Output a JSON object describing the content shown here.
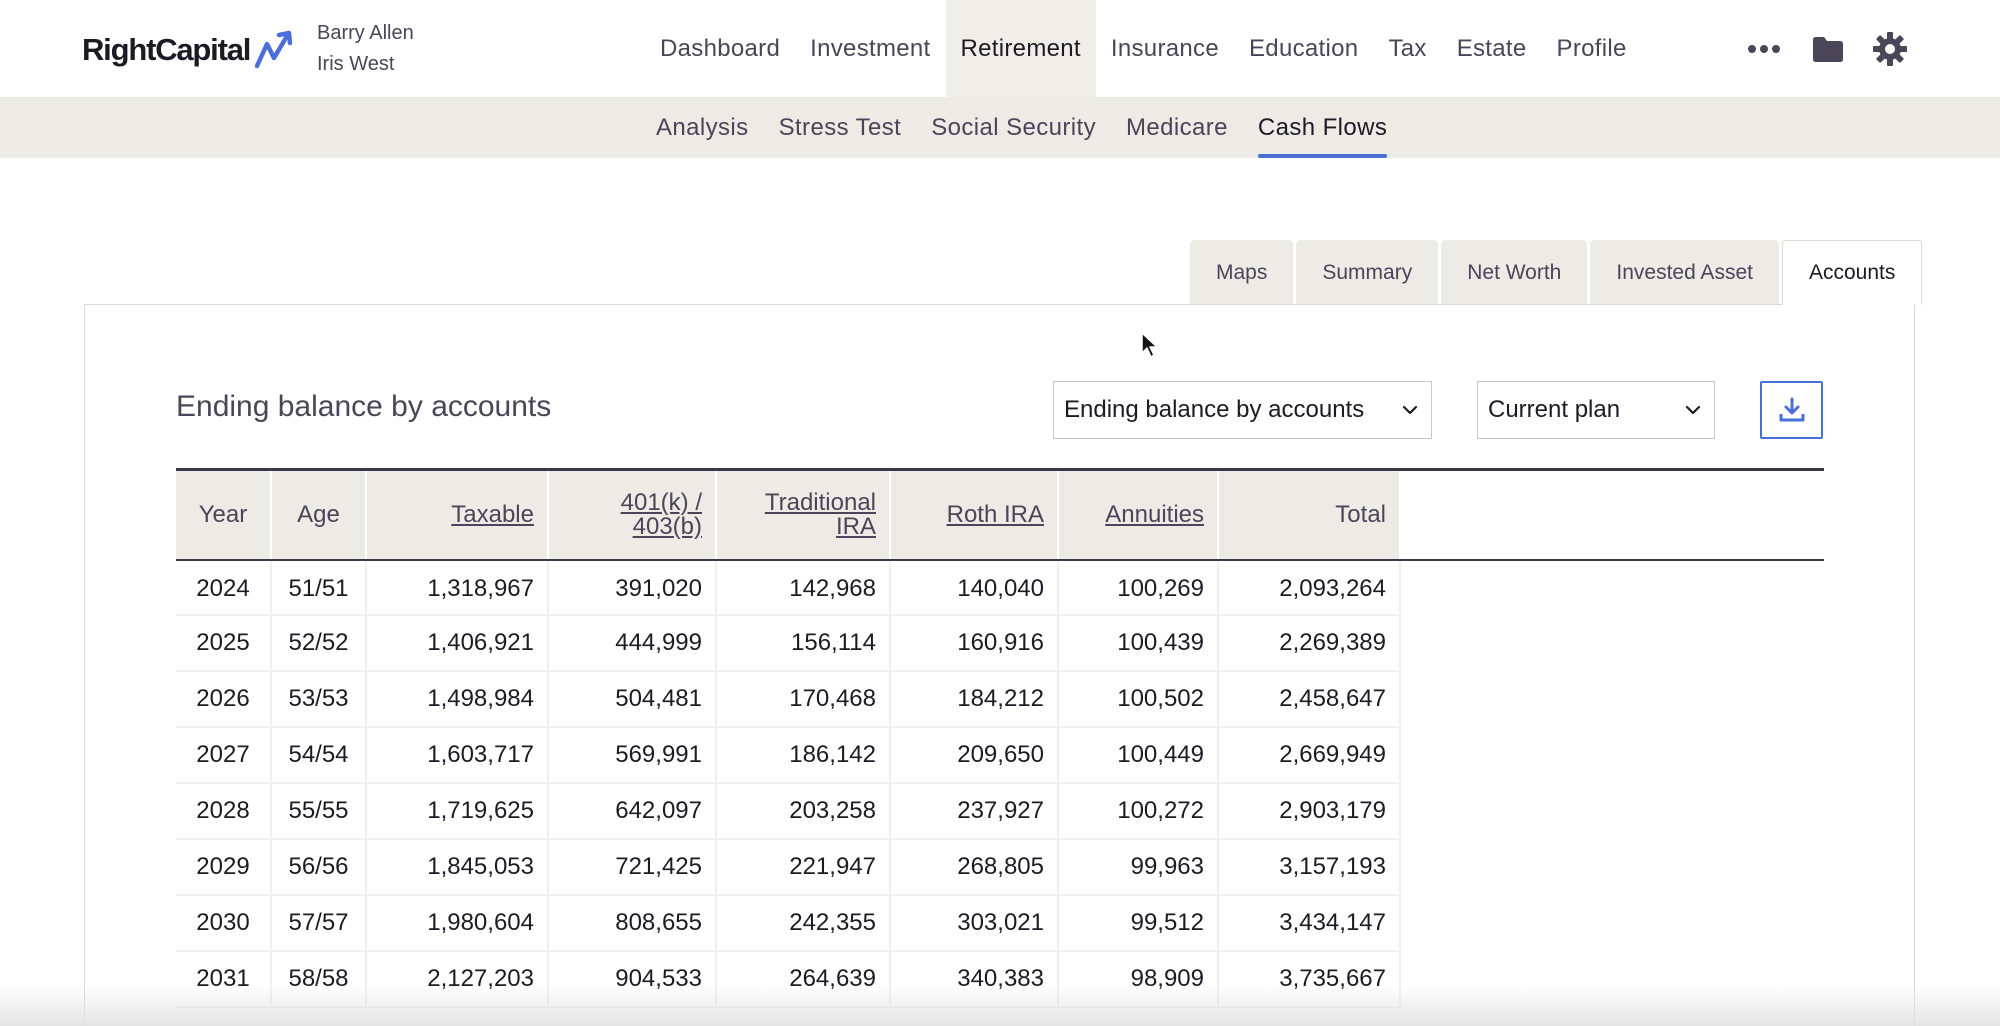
{
  "header": {
    "logo_text": "RightCapital",
    "clients": [
      "Barry Allen",
      "Iris West"
    ],
    "nav": [
      "Dashboard",
      "Investment",
      "Retirement",
      "Insurance",
      "Education",
      "Tax",
      "Estate",
      "Profile"
    ],
    "active_nav": "Retirement",
    "icons": [
      "more-icon",
      "folder-icon",
      "gear-icon"
    ]
  },
  "subnav": {
    "items": [
      "Analysis",
      "Stress Test",
      "Social Security",
      "Medicare",
      "Cash Flows"
    ],
    "active": "Cash Flows"
  },
  "tabs": {
    "items": [
      "Maps",
      "Summary",
      "Net Worth",
      "Invested Asset",
      "Accounts"
    ],
    "active": "Accounts"
  },
  "section": {
    "title": "Ending balance by accounts",
    "view_select": "Ending balance by accounts",
    "plan_select": "Current plan",
    "download_icon": "download-icon"
  },
  "table": {
    "headers": [
      "Year",
      "Age",
      "Taxable",
      "401(k) / 403(b)",
      "Traditional IRA",
      "Roth IRA",
      "Annuities",
      "Total"
    ],
    "rows": [
      [
        "2024",
        "51/51",
        "1,318,967",
        "391,020",
        "142,968",
        "140,040",
        "100,269",
        "2,093,264"
      ],
      [
        "2025",
        "52/52",
        "1,406,921",
        "444,999",
        "156,114",
        "160,916",
        "100,439",
        "2,269,389"
      ],
      [
        "2026",
        "53/53",
        "1,498,984",
        "504,481",
        "170,468",
        "184,212",
        "100,502",
        "2,458,647"
      ],
      [
        "2027",
        "54/54",
        "1,603,717",
        "569,991",
        "186,142",
        "209,650",
        "100,449",
        "2,669,949"
      ],
      [
        "2028",
        "55/55",
        "1,719,625",
        "642,097",
        "203,258",
        "237,927",
        "100,272",
        "2,903,179"
      ],
      [
        "2029",
        "56/56",
        "1,845,053",
        "721,425",
        "221,947",
        "268,805",
        "99,963",
        "3,157,193"
      ],
      [
        "2030",
        "57/57",
        "1,980,604",
        "808,655",
        "242,355",
        "303,021",
        "99,512",
        "3,434,147"
      ],
      [
        "2031",
        "58/58",
        "2,127,203",
        "904,533",
        "264,639",
        "340,383",
        "98,909",
        "3,735,667"
      ]
    ]
  },
  "colors": {
    "accent": "#4a6fd6",
    "nav_bg": "#ecebe6",
    "text": "#1d1a24"
  }
}
